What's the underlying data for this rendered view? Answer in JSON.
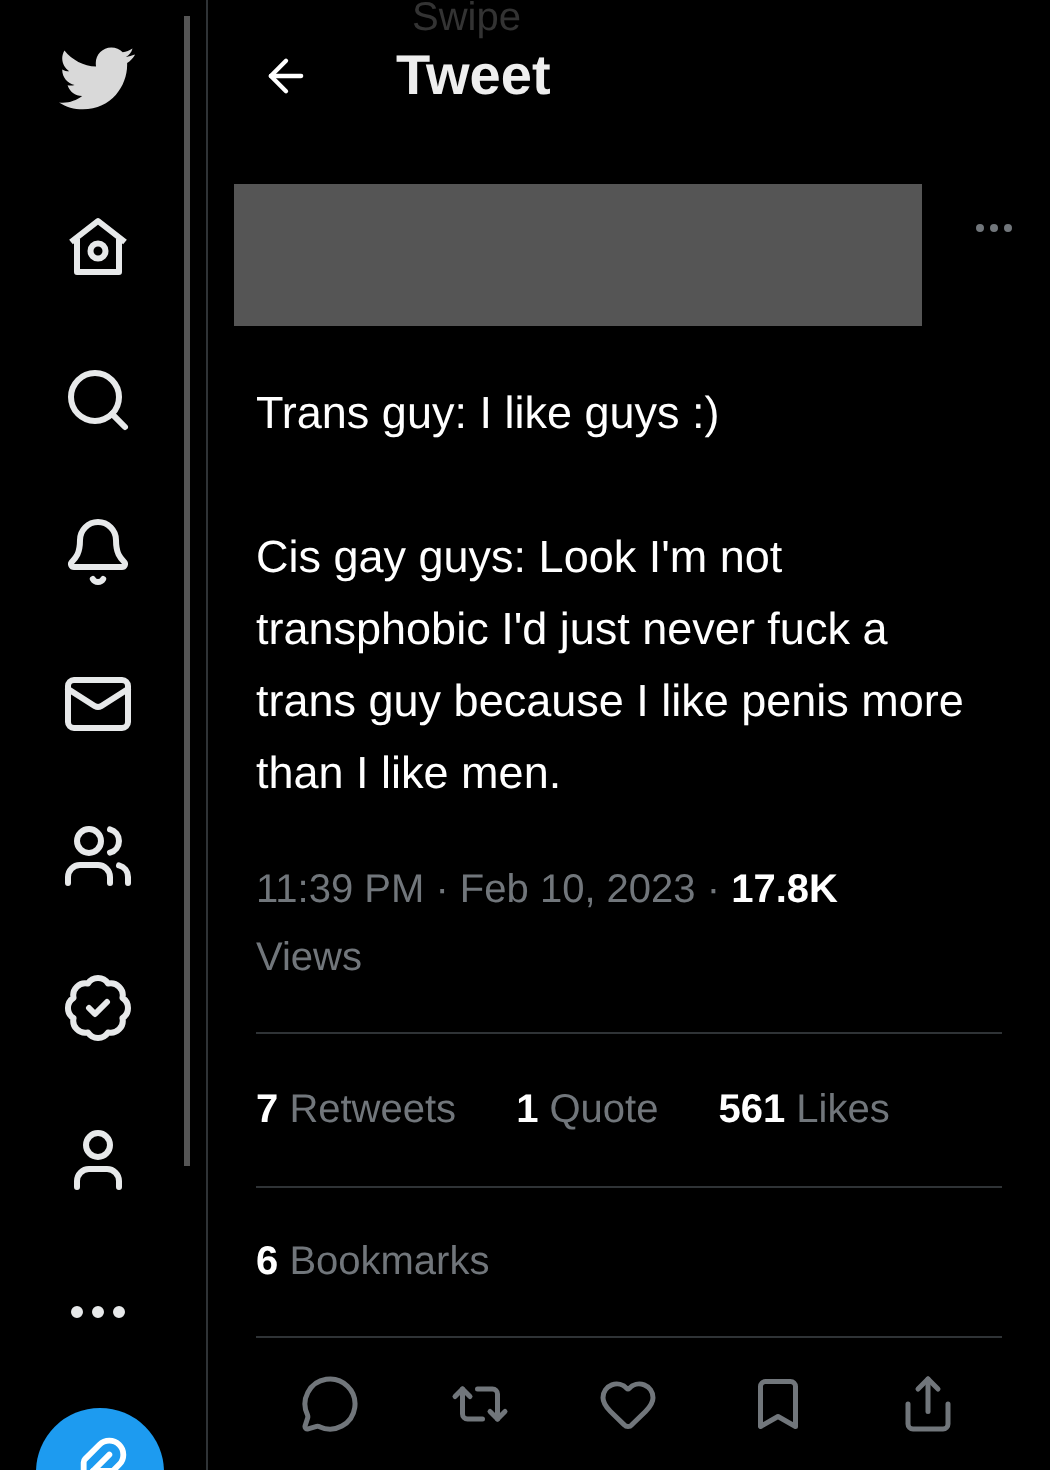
{
  "header": {
    "title": "Tweet",
    "background_text": "Swipe"
  },
  "sidebar": {
    "items": [
      {
        "kind": "home"
      },
      {
        "kind": "search"
      },
      {
        "kind": "bell"
      },
      {
        "kind": "mail"
      },
      {
        "kind": "people"
      },
      {
        "kind": "verified"
      },
      {
        "kind": "person"
      },
      {
        "kind": "more"
      }
    ]
  },
  "tweet": {
    "author_redacted": true,
    "text": [
      "Trans guy: I like guys :)",
      "Cis gay guys: Look I'm not transphobic I'd just never fuck a trans guy because I like penis more than I like men."
    ],
    "time": "11:39 PM",
    "separator": "·",
    "date": "Feb 10, 2023",
    "views_count": "17.8K",
    "views_label": "Views",
    "stats": [
      {
        "count": "7",
        "label": "Retweets"
      },
      {
        "count": "1",
        "label": "Quote"
      },
      {
        "count": "561",
        "label": "Likes"
      }
    ],
    "bookmarks": {
      "count": "6",
      "label": "Bookmarks"
    },
    "actions": [
      {
        "kind": "reply"
      },
      {
        "kind": "retweet"
      },
      {
        "kind": "like"
      },
      {
        "kind": "bookmark"
      },
      {
        "kind": "share"
      }
    ]
  }
}
